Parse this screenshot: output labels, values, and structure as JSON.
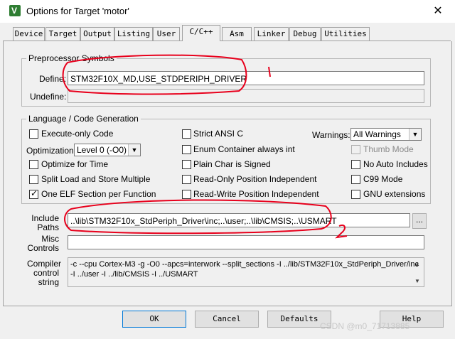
{
  "window": {
    "title": "Options for Target 'motor'",
    "app_icon": "V",
    "close_glyph": "✕"
  },
  "tabs": [
    "Device",
    "Target",
    "Output",
    "Listing",
    "User",
    "C/C++",
    "Asm",
    "Linker",
    "Debug",
    "Utilities"
  ],
  "active_tab": "C/C++",
  "preprocessor": {
    "title": "Preprocessor Symbols",
    "define_label": "Define:",
    "define_value": "STM32F10X_MD,USE_STDPERIPH_DRIVER",
    "undefine_label": "Undefine:",
    "undefine_value": ""
  },
  "language": {
    "title": "Language / Code Generation",
    "execute_only": "Execute-only Code",
    "optimization_label": "Optimization:",
    "optimization_value": "Level 0 (-O0)",
    "optimize_time": "Optimize for Time",
    "split_load": "Split Load and Store Multiple",
    "one_elf": "One ELF Section per Function",
    "strict_ansi": "Strict ANSI C",
    "enum_container": "Enum Container always int",
    "plain_char": "Plain Char is Signed",
    "read_only": "Read-Only Position Independent",
    "read_write": "Read-Write Position Independent",
    "warnings_label": "Warnings:",
    "warnings_value": "All Warnings",
    "thumb_mode": "Thumb Mode",
    "no_auto": "No Auto Includes",
    "c99": "C99 Mode",
    "gnu": "GNU extensions",
    "check_mark": "✓"
  },
  "include": {
    "label_line1": "Include",
    "label_line2": "Paths",
    "value": "..\\lib\\STM32F10x_StdPeriph_Driver\\inc;..\\user;..\\lib\\CMSIS;..\\USMART",
    "browse": "..."
  },
  "misc": {
    "label_line1": "Misc",
    "label_line2": "Controls",
    "value": ""
  },
  "compiler": {
    "label_line1": "Compiler",
    "label_line2": "control",
    "label_line3": "string",
    "line1": "-c --cpu Cortex-M3 -g -O0 --apcs=interwork --split_sections -I ../lib/STM32F10x_StdPeriph_Driver/inc",
    "line2": "-I ../user -I ../lib/CMSIS -I ../USMART"
  },
  "buttons": {
    "ok": "OK",
    "cancel": "Cancel",
    "defaults": "Defaults",
    "help": "Help"
  },
  "annotations": {
    "mark1": "1",
    "mark2": "2"
  },
  "watermark": "CSDN @m0_71713885",
  "colors": {
    "annotation": "#e8001c",
    "focus": "#0078d7",
    "dialog_bg": "#f0f0f0"
  }
}
